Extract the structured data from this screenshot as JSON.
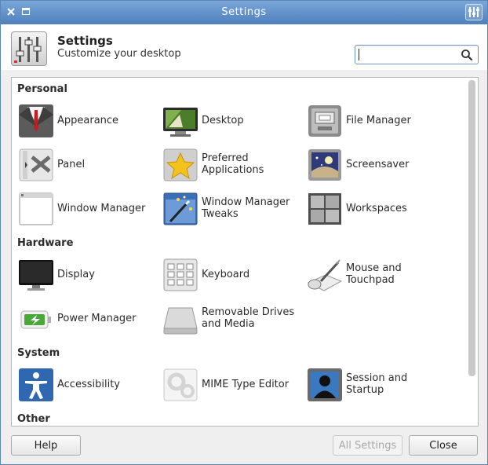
{
  "window": {
    "title": "Settings"
  },
  "header": {
    "title": "Settings",
    "subtitle": "Customize your desktop",
    "search_placeholder": ""
  },
  "sections": {
    "personal": {
      "title": "Personal",
      "items": [
        {
          "label": "Appearance",
          "icon": "appearance-icon"
        },
        {
          "label": "Desktop",
          "icon": "desktop-icon"
        },
        {
          "label": "File Manager",
          "icon": "file-manager-icon"
        },
        {
          "label": "Panel",
          "icon": "panel-icon"
        },
        {
          "label": "Preferred Applications",
          "icon": "star-icon"
        },
        {
          "label": "Screensaver",
          "icon": "screensaver-icon"
        },
        {
          "label": "Window Manager",
          "icon": "window-icon"
        },
        {
          "label": "Window Manager Tweaks",
          "icon": "magic-wand-icon"
        },
        {
          "label": "Workspaces",
          "icon": "workspaces-icon"
        }
      ]
    },
    "hardware": {
      "title": "Hardware",
      "items": [
        {
          "label": "Display",
          "icon": "monitor-icon"
        },
        {
          "label": "Keyboard",
          "icon": "keyboard-icon"
        },
        {
          "label": "Mouse and Touchpad",
          "icon": "mouse-icon"
        },
        {
          "label": "Power Manager",
          "icon": "battery-icon"
        },
        {
          "label": "Removable Drives and Media",
          "icon": "drive-icon"
        }
      ]
    },
    "system": {
      "title": "System",
      "items": [
        {
          "label": "Accessibility",
          "icon": "accessibility-icon"
        },
        {
          "label": "MIME Type Editor",
          "icon": "gears-icon"
        },
        {
          "label": "Session and Startup",
          "icon": "session-icon"
        }
      ]
    },
    "other": {
      "title": "Other"
    }
  },
  "buttons": {
    "help": "Help",
    "all_settings": "All Settings",
    "close": "Close"
  }
}
